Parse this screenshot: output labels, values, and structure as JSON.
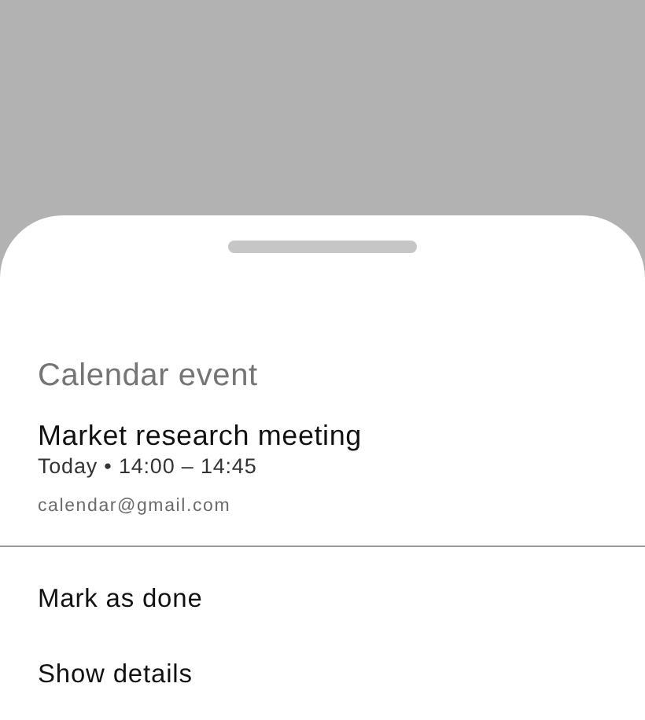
{
  "sheet": {
    "title": "Calendar event",
    "event": {
      "title": "Market research meeting",
      "time": "Today • 14:00 – 14:45",
      "account": "calendar@gmail.com"
    },
    "actions": [
      {
        "label": "Mark as done"
      },
      {
        "label": "Show details"
      }
    ]
  }
}
